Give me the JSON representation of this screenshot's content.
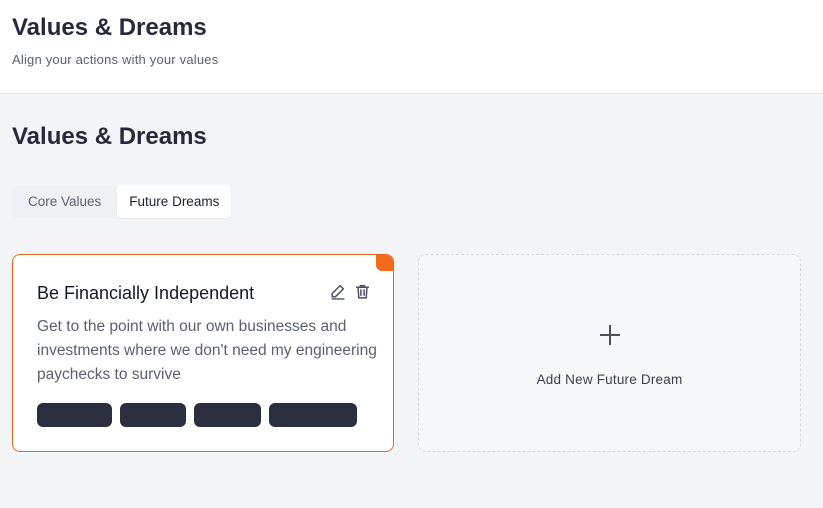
{
  "header": {
    "title": "Values & Dreams",
    "subtitle": "Align your actions with your values"
  },
  "main": {
    "title": "Values & Dreams",
    "tabs": [
      {
        "label": "Core Values",
        "active": false
      },
      {
        "label": "Future Dreams",
        "active": true
      }
    ],
    "dream_card": {
      "title": "Be Financially Independent",
      "description": "Get to the point with our own businesses and investments where we don't need my engineering paychecks to survive",
      "edit_icon": "pencil-icon",
      "delete_icon": "trash-icon",
      "tag_count_visible": 4
    },
    "add_card": {
      "icon": "plus-icon",
      "label": "Add New Future Dream"
    }
  },
  "colors": {
    "accent": "#f26a1b",
    "card_border": "#e4671f",
    "tag_bg": "#2b2e3f",
    "text_dark": "#262a3a",
    "text_muted": "#5b6070"
  }
}
